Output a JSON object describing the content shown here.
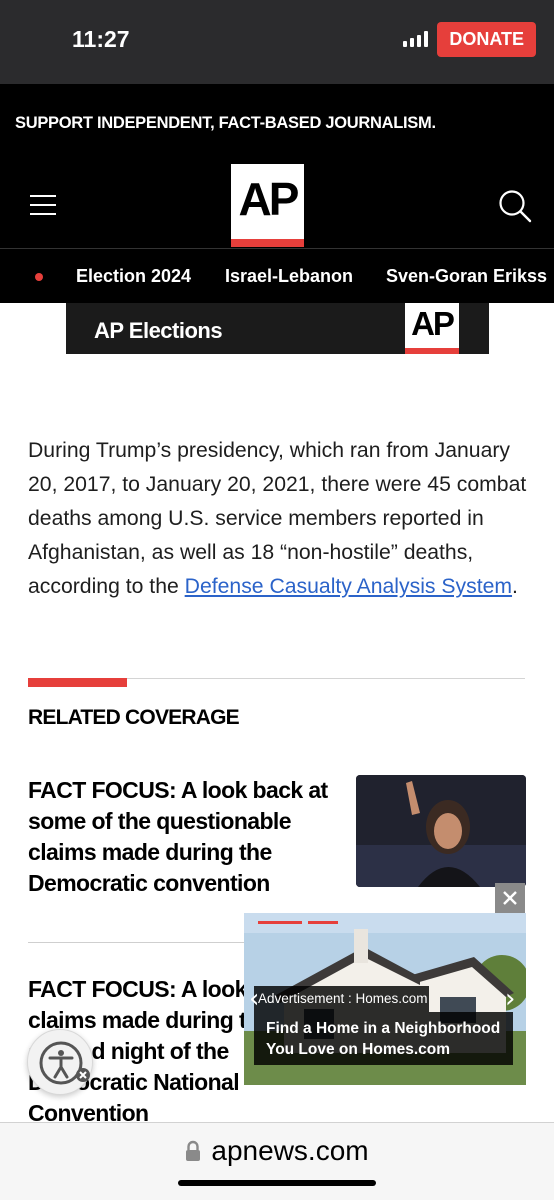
{
  "status_bar": {
    "time": "11:27"
  },
  "header": {
    "support_text": "SUPPORT INDEPENDENT, FACT-BASED JOURNALISM.",
    "donate_label": "DONATE",
    "logo_text": "AP",
    "accent_color": "#e63f3b"
  },
  "topics": [
    "Election 2024",
    "Israel-Lebanon",
    "Sven-Goran Erikss"
  ],
  "elections_banner": {
    "label": "AP Elections",
    "logo_text": "AP"
  },
  "article": {
    "text_before_link": "During Trump’s presidency, which ran from January 20, 2017, to January 20, 2021, there were 45 combat deaths among U.S. service members reported in Afghanistan, as well as 18 “non-hostile” deaths, according to the ",
    "link_text": "Defense Casualty Analysis System",
    "text_after_link": "."
  },
  "related": {
    "heading": "RELATED COVERAGE",
    "stories": [
      {
        "title": "FACT FOCUS: A look back at some of the questionable claims made during the Democratic convention"
      },
      {
        "title": "FACT FOCUS: A look back at claims made during the second night of the Democratic National Convention"
      }
    ]
  },
  "ad": {
    "label": "Advertisement : Homes.com",
    "caption": "Find a Home in a Neighborhood You Love on Homes.com",
    "close_symbol": "✕",
    "prev_symbol": "‹",
    "next_symbol": "›"
  },
  "browser": {
    "url": "apnews.com"
  },
  "icons": [
    "hamburger-icon",
    "search-icon",
    "accessibility-icon",
    "lock-icon",
    "close-icon"
  ]
}
